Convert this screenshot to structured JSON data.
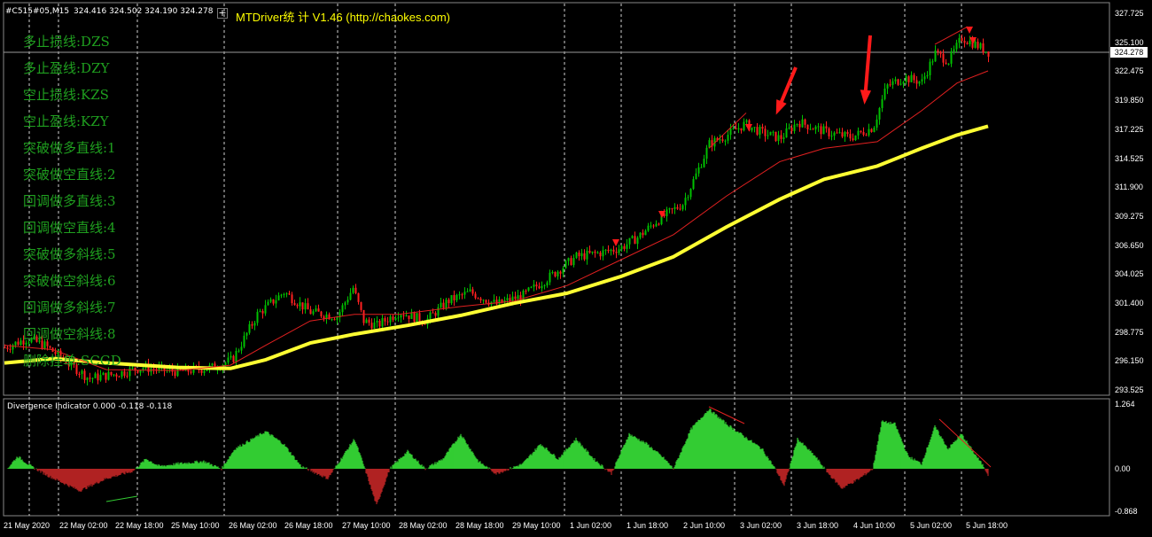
{
  "header": {
    "symbol_info": "#C515#05,M15",
    "ohlc": "324.416 324.502 324.190 324.278",
    "ea_title": "MTDriver统 计  V1.46  (http://chaokes.com)"
  },
  "legend": [
    "多止损线:DZS",
    "多止盈线:DZY",
    "空止损线:KZS",
    "空止盈线:KZY",
    "突破做多直线:1",
    "突破做空直线:2",
    "回调做多直线:3",
    "回调做空直线:4",
    "突破做多斜线:5",
    "突破做空斜线:6",
    "回调做多斜线:7",
    "回调做空斜线:8",
    "删除挂单:SCGD"
  ],
  "price_axis": [
    "327.725",
    "325.100",
    "322.475",
    "319.850",
    "317.225",
    "314.525",
    "311.900",
    "309.275",
    "306.650",
    "304.025",
    "301.400",
    "298.775",
    "296.150",
    "293.525"
  ],
  "current_price": "324.278",
  "indicator": {
    "title": "Divergence Indicator 0.000 -0.118 -0.118",
    "axis": [
      "1.264",
      "0.00",
      "-0.868"
    ]
  },
  "time_axis": [
    "21 May 2020",
    "22 May 02:00",
    "22 May 18:00",
    "25 May 10:00",
    "26 May 02:00",
    "26 May 18:00",
    "27 May 10:00",
    "28 May 02:00",
    "28 May 18:00",
    "29 May 10:00",
    "1 Jun 02:00",
    "1 Jun 18:00",
    "2 Jun 10:00",
    "3 Jun 02:00",
    "3 Jun 18:00",
    "4 Jun 10:00",
    "5 Jun 02:00",
    "5 Jun 18:00"
  ],
  "colors": {
    "background": "#000000",
    "bull_candle": "#00c000",
    "bear_candle": "#ff2020",
    "ma_slow": "#ffff33",
    "ma_fast": "#e02020",
    "hist_pos": "#33cc33",
    "hist_neg": "#b02222",
    "legend_text": "#1f9f1f",
    "arrow": "#ff1a1a"
  }
}
